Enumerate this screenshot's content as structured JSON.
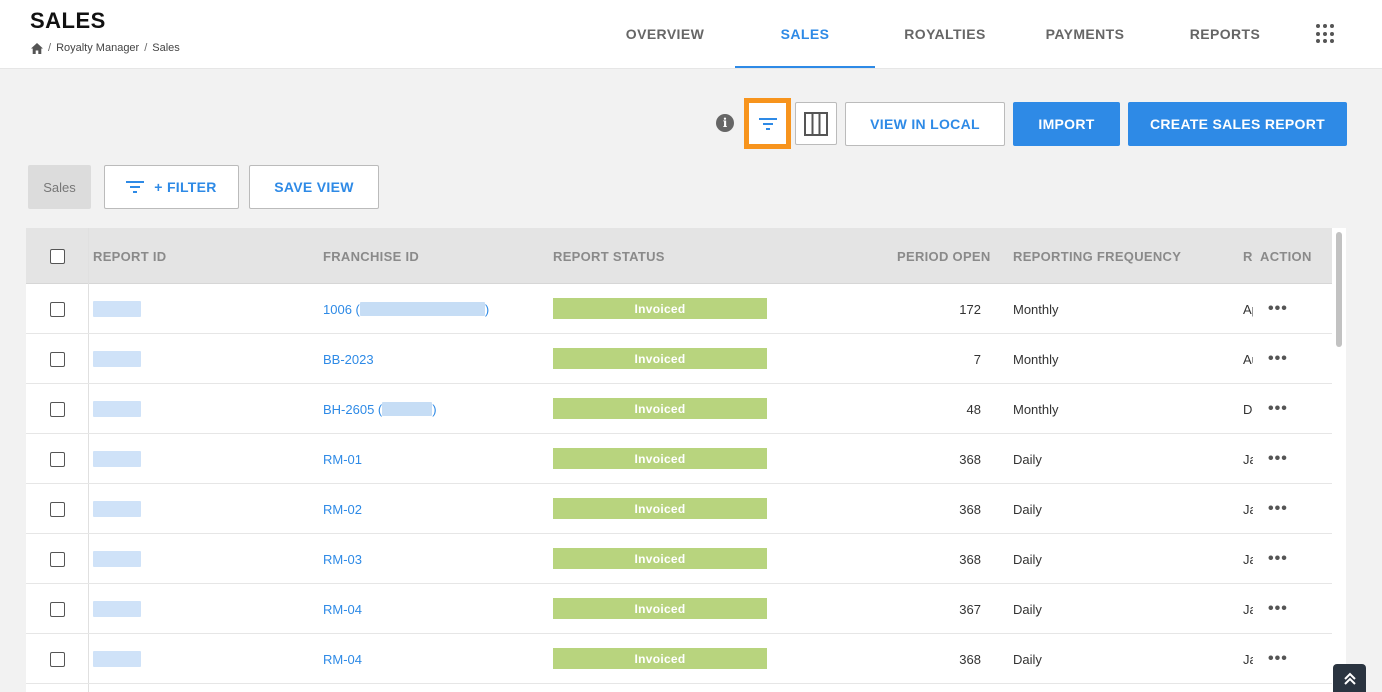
{
  "header": {
    "title": "SALES",
    "breadcrumb": [
      "Royalty Manager",
      "Sales"
    ],
    "separator": "/"
  },
  "nav": {
    "tabs": [
      {
        "label": "OVERVIEW",
        "active": false
      },
      {
        "label": "SALES",
        "active": true
      },
      {
        "label": "ROYALTIES",
        "active": false
      },
      {
        "label": "PAYMENTS",
        "active": false
      },
      {
        "label": "REPORTS",
        "active": false
      }
    ]
  },
  "toolbar": {
    "info_icon": "info-icon",
    "view_in_local_label": "VIEW IN LOCAL",
    "import_label": "IMPORT",
    "create_label": "CREATE SALES REPORT"
  },
  "views": {
    "current_view": "Sales",
    "filter_label": "+ FILTER",
    "save_view_label": "SAVE VIEW"
  },
  "table": {
    "columns": {
      "report_id": "REPORT ID",
      "franchise_id": "FRANCHISE ID",
      "report_status": "REPORT STATUS",
      "period_open": "PERIOD OPEN",
      "reporting_frequency": "REPORTING FREQUENCY",
      "r": "R",
      "action": "ACTION"
    },
    "rows": [
      {
        "franchise": "1006 (",
        "franchise_suffix": ")",
        "status": "Invoiced",
        "period_open": "172",
        "frequency": "Monthly",
        "r": "Ap"
      },
      {
        "franchise": "BB-2023",
        "franchise_suffix": "",
        "status": "Invoiced",
        "period_open": "7",
        "frequency": "Monthly",
        "r": "Au"
      },
      {
        "franchise": "BH-2605 (",
        "franchise_suffix": ")",
        "status": "Invoiced",
        "period_open": "48",
        "frequency": "Monthly",
        "r": "De"
      },
      {
        "franchise": "RM-01",
        "franchise_suffix": "",
        "status": "Invoiced",
        "period_open": "368",
        "frequency": "Daily",
        "r": "Ja"
      },
      {
        "franchise": "RM-02",
        "franchise_suffix": "",
        "status": "Invoiced",
        "period_open": "368",
        "frequency": "Daily",
        "r": "Ja"
      },
      {
        "franchise": "RM-03",
        "franchise_suffix": "",
        "status": "Invoiced",
        "period_open": "368",
        "frequency": "Daily",
        "r": "Ja"
      },
      {
        "franchise": "RM-04",
        "franchise_suffix": "",
        "status": "Invoiced",
        "period_open": "367",
        "frequency": "Daily",
        "r": "Ja"
      },
      {
        "franchise": "RM-04",
        "franchise_suffix": "",
        "status": "Invoiced",
        "period_open": "368",
        "frequency": "Daily",
        "r": "Ja"
      }
    ],
    "action_glyph": "•••"
  },
  "colors": {
    "accent": "#2e8ae6",
    "highlight": "#f7941d",
    "status_invoiced": "#b8d47e"
  }
}
